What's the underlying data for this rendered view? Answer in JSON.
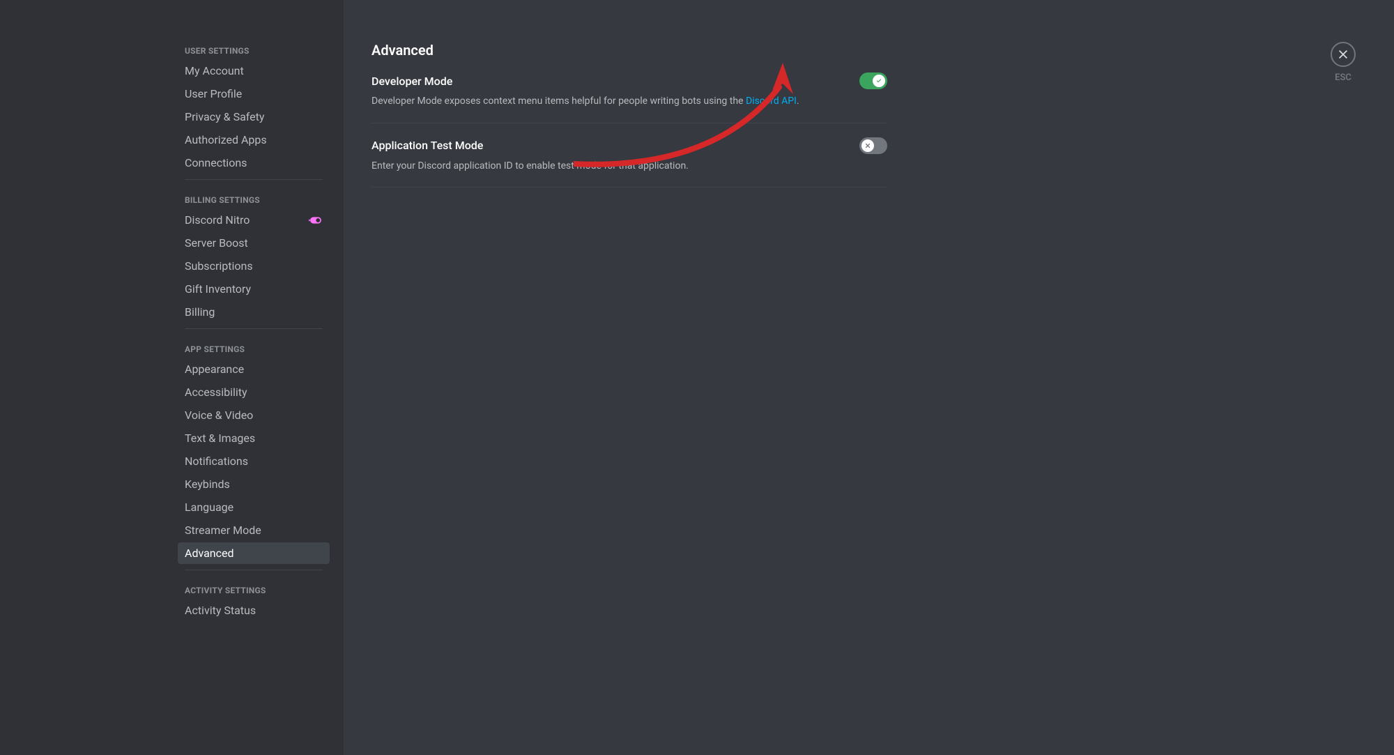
{
  "sidebar": {
    "sections": [
      {
        "header": "USER SETTINGS",
        "items": [
          {
            "label": "My Account",
            "slug": "my-account"
          },
          {
            "label": "User Profile",
            "slug": "user-profile"
          },
          {
            "label": "Privacy & Safety",
            "slug": "privacy-safety"
          },
          {
            "label": "Authorized Apps",
            "slug": "authorized-apps"
          },
          {
            "label": "Connections",
            "slug": "connections"
          }
        ]
      },
      {
        "header": "BILLING SETTINGS",
        "items": [
          {
            "label": "Discord Nitro",
            "slug": "discord-nitro",
            "icon": "nitro"
          },
          {
            "label": "Server Boost",
            "slug": "server-boost"
          },
          {
            "label": "Subscriptions",
            "slug": "subscriptions"
          },
          {
            "label": "Gift Inventory",
            "slug": "gift-inventory"
          },
          {
            "label": "Billing",
            "slug": "billing"
          }
        ]
      },
      {
        "header": "APP SETTINGS",
        "items": [
          {
            "label": "Appearance",
            "slug": "appearance"
          },
          {
            "label": "Accessibility",
            "slug": "accessibility"
          },
          {
            "label": "Voice & Video",
            "slug": "voice-video"
          },
          {
            "label": "Text & Images",
            "slug": "text-images"
          },
          {
            "label": "Notifications",
            "slug": "notifications"
          },
          {
            "label": "Keybinds",
            "slug": "keybinds"
          },
          {
            "label": "Language",
            "slug": "language"
          },
          {
            "label": "Streamer Mode",
            "slug": "streamer-mode"
          },
          {
            "label": "Advanced",
            "slug": "advanced",
            "active": true
          }
        ]
      },
      {
        "header": "ACTIVITY SETTINGS",
        "items": [
          {
            "label": "Activity Status",
            "slug": "activity-status"
          }
        ]
      }
    ]
  },
  "main": {
    "title": "Advanced",
    "settings": [
      {
        "title": "Developer Mode",
        "description_prefix": "Developer Mode exposes context menu items helpful for people writing bots using the ",
        "description_link": "Discord API",
        "description_suffix": ".",
        "enabled": true
      },
      {
        "title": "Application Test Mode",
        "description": "Enter your Discord application ID to enable test mode for that application.",
        "enabled": false
      }
    ]
  },
  "close": {
    "label": "ESC"
  },
  "colors": {
    "accent_green": "#3ba55d",
    "link_blue": "#00aff4",
    "nitro_pink": "#ff73fa",
    "annotation_red": "#d62828"
  }
}
